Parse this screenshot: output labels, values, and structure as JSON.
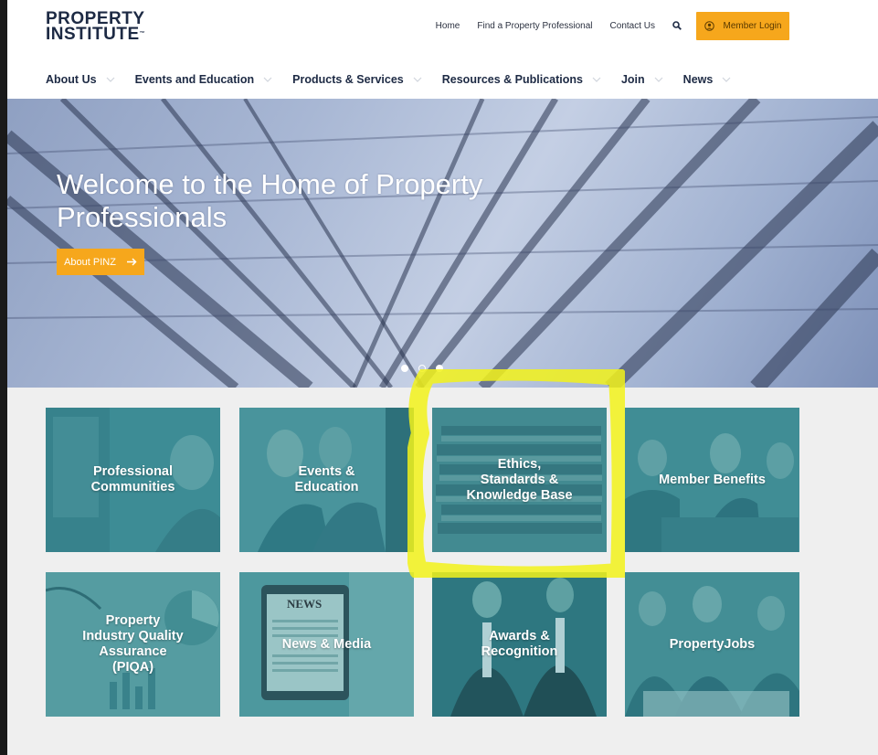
{
  "logo": {
    "line1": "PROPERTY",
    "line2": "INSTITUTE",
    "tm": "™"
  },
  "topnav": {
    "items": [
      "Home",
      "Find a Property Professional",
      "Contact Us"
    ],
    "search_icon": "search-icon",
    "login_label": "Member Login",
    "login_icon": "user-circle-icon"
  },
  "mainnav": {
    "items": [
      "About Us",
      "Events and Education",
      "Products & Services",
      "Resources & Publications",
      "Join",
      "News"
    ]
  },
  "hero": {
    "title": "Welcome to the Home of Property Professionals",
    "button": "About PINZ",
    "slides_total": 3,
    "active_slide": 1
  },
  "tiles": [
    {
      "label": "Professional\nCommunities"
    },
    {
      "label": "Events &\nEducation"
    },
    {
      "label": "Ethics,\nStandards &\nKnowledge Base"
    },
    {
      "label": "Member Benefits"
    },
    {
      "label": "Property\nIndustry Quality\nAssurance\n(PIQA)"
    },
    {
      "label": "News & Media"
    },
    {
      "label": "Awards &\nRecognition"
    },
    {
      "label": "PropertyJobs"
    }
  ],
  "tile_news_sign": "NEWS",
  "colors": {
    "accent": "#f6a71c",
    "navy": "#1d2a44",
    "tile_overlay": "#2f8a95",
    "highlight": "#f2f21a"
  }
}
